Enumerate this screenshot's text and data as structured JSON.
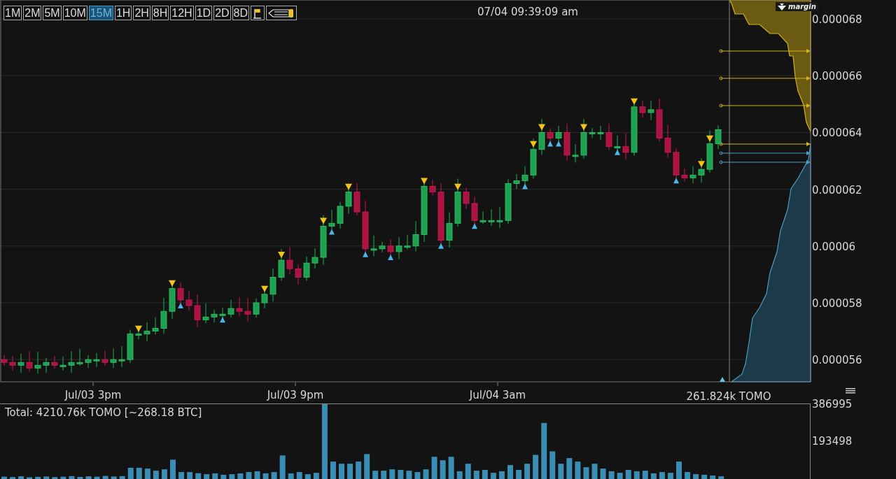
{
  "toolbar": {
    "intervals": [
      {
        "label": "1M",
        "selected": false
      },
      {
        "label": "2M",
        "selected": false
      },
      {
        "label": "5M",
        "selected": false
      },
      {
        "label": "10M",
        "selected": false
      },
      {
        "label": "15M",
        "selected": true
      },
      {
        "label": "1H",
        "selected": false
      },
      {
        "label": "2H",
        "selected": false
      },
      {
        "label": "8H",
        "selected": false
      },
      {
        "label": "12H",
        "selected": false
      },
      {
        "label": "1D",
        "selected": false
      },
      {
        "label": "2D",
        "selected": false
      },
      {
        "label": "8D",
        "selected": false
      }
    ]
  },
  "timestamp": "07/04 09:39:09 am",
  "price_chart": {
    "price_axis": [
      "0.000068",
      "0.000066",
      "0.000064",
      "0.000062",
      "0.00006",
      "0.000058",
      "0.000056"
    ],
    "time_axis": [
      "Jul/03 3pm",
      "Jul/03 9pm",
      "Jul/04 3am"
    ],
    "depth_label": "margin",
    "cursor_volume": "261.824k TOMO"
  },
  "volume_panel": {
    "total_label": "Total: 4210.76k TOMO [~268.18 BTC]",
    "chart_data": {
      "type": "bar",
      "ylim": [
        0,
        386995
      ],
      "yticks": [
        193498,
        386995
      ],
      "series": [
        {
          "color": "#3a8db5",
          "values": [
            12000,
            10000,
            14000,
            9000,
            11000,
            13000,
            10000,
            12000,
            15000,
            11000,
            14000,
            12000,
            16000,
            13000,
            15000,
            58000,
            58000,
            54000,
            43000,
            50000,
            100000,
            36000,
            36000,
            30000,
            25000,
            29000,
            22000,
            25000,
            29000,
            36000,
            40000,
            29000,
            36000,
            122000,
            29000,
            36000,
            25000,
            32000,
            386995,
            90000,
            79000,
            79000,
            90000,
            129000,
            43000,
            43000,
            50000,
            47000,
            43000,
            36000,
            50000,
            115000,
            97000,
            115000,
            40000,
            79000,
            43000,
            47000,
            32000,
            40000,
            72000,
            47000,
            79000,
            125000,
            290000,
            143000,
            79000,
            108000,
            90000,
            61000,
            79000,
            54000,
            40000,
            32000,
            47000,
            40000,
            43000,
            29000,
            36000,
            32000,
            90000,
            36000,
            25000,
            22000,
            18000,
            14000,
            null,
            null,
            null,
            null,
            null,
            null,
            null,
            null,
            null,
            null
          ]
        }
      ]
    }
  }
}
